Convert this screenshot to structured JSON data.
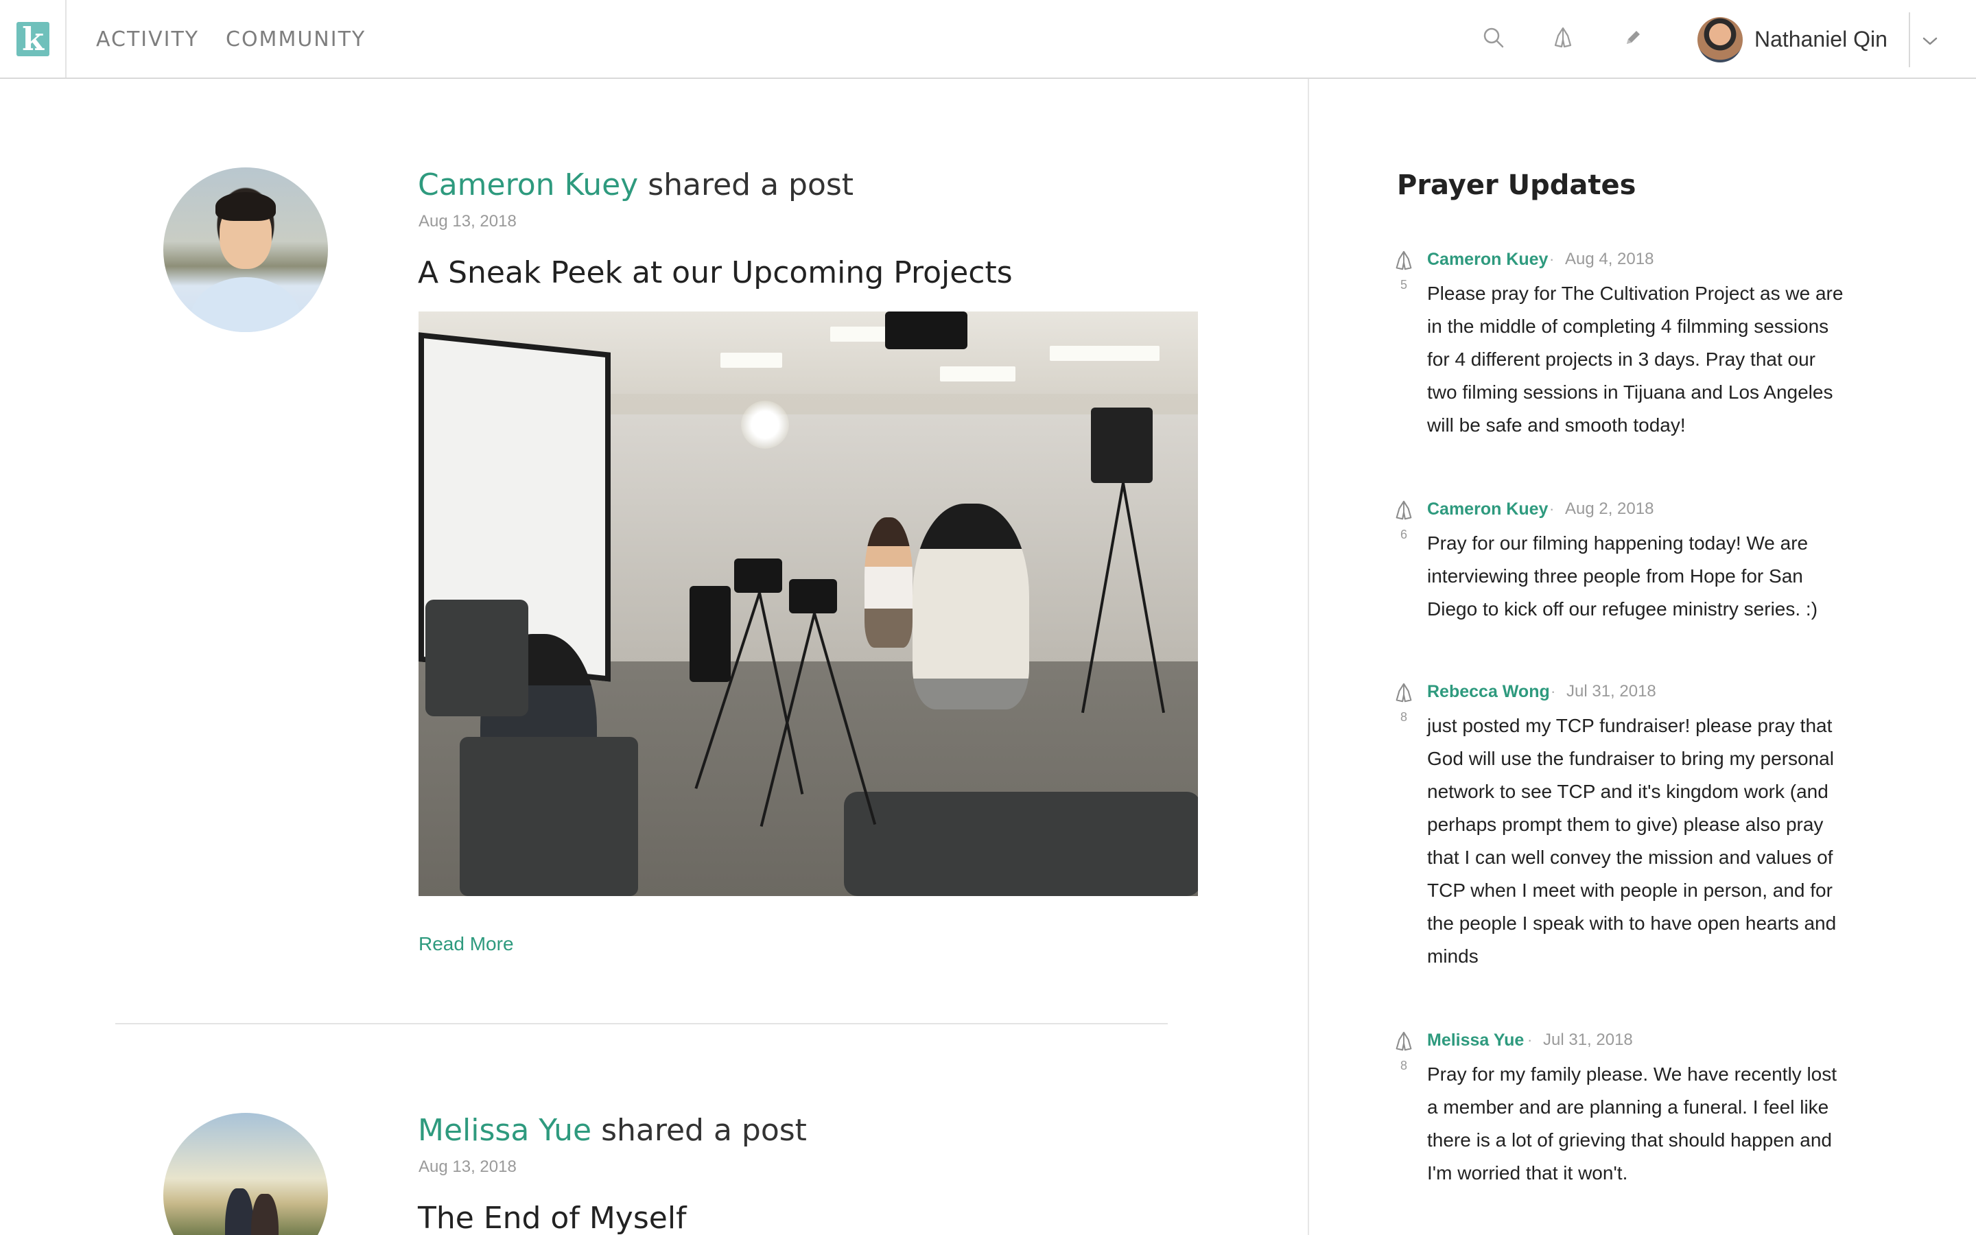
{
  "header": {
    "logo_letter": "k",
    "nav": [
      "ACTIVITY",
      "COMMUNITY"
    ],
    "icons": [
      "search-icon",
      "prayer-hands-icon",
      "pencil-icon",
      "chevron-down-icon"
    ],
    "user_name": "Nathaniel Qin"
  },
  "feed": {
    "posts": [
      {
        "author": "Cameron Kuey",
        "action": " shared a post",
        "date": "Aug 13, 2018",
        "title": "A Sneak Peek at our Upcoming Projects",
        "read_more": "Read More"
      },
      {
        "author": "Melissa Yue",
        "action": " shared a post",
        "date": "Aug 13, 2018",
        "title": "The End of Myself"
      }
    ]
  },
  "prayer_updates": {
    "title": "Prayer Updates",
    "items": [
      {
        "author": "Cameron Kuey",
        "date": "Aug 4, 2018",
        "count": "5",
        "text": "Please pray for The Cultivation Project as we are in the middle of completing 4 filmming sessions for 4 different projects in 3 days. Pray that our two filming sessions in Tijuana and Los Angeles will be safe and smooth today!"
      },
      {
        "author": "Cameron Kuey",
        "date": "Aug 2, 2018",
        "count": "6",
        "text": "Pray for our filming happening today! We are interviewing three people from Hope for San Diego to kick off our refugee ministry series. :)"
      },
      {
        "author": "Rebecca Wong",
        "date": "Jul 31, 2018",
        "count": "8",
        "text": "just posted my TCP fundraiser! please pray that God will use the fundraiser to bring my personal network to see TCP and it's kingdom work (and perhaps prompt them to give) please also pray that I can well convey the mission and values of TCP when I meet with people in person, and for the people I speak with to have open hearts and minds"
      },
      {
        "author": "Melissa Yue",
        "date": "Jul 31, 2018",
        "count": "8",
        "text": "Pray for my family please. We have recently lost a member and are planning a funeral. I feel like there is a lot of grieving that should happen and I'm worried that it won't."
      }
    ]
  },
  "colors": {
    "accent": "#2e9a7e",
    "logo": "#6fc0bb",
    "muted": "#9a9a9a"
  }
}
